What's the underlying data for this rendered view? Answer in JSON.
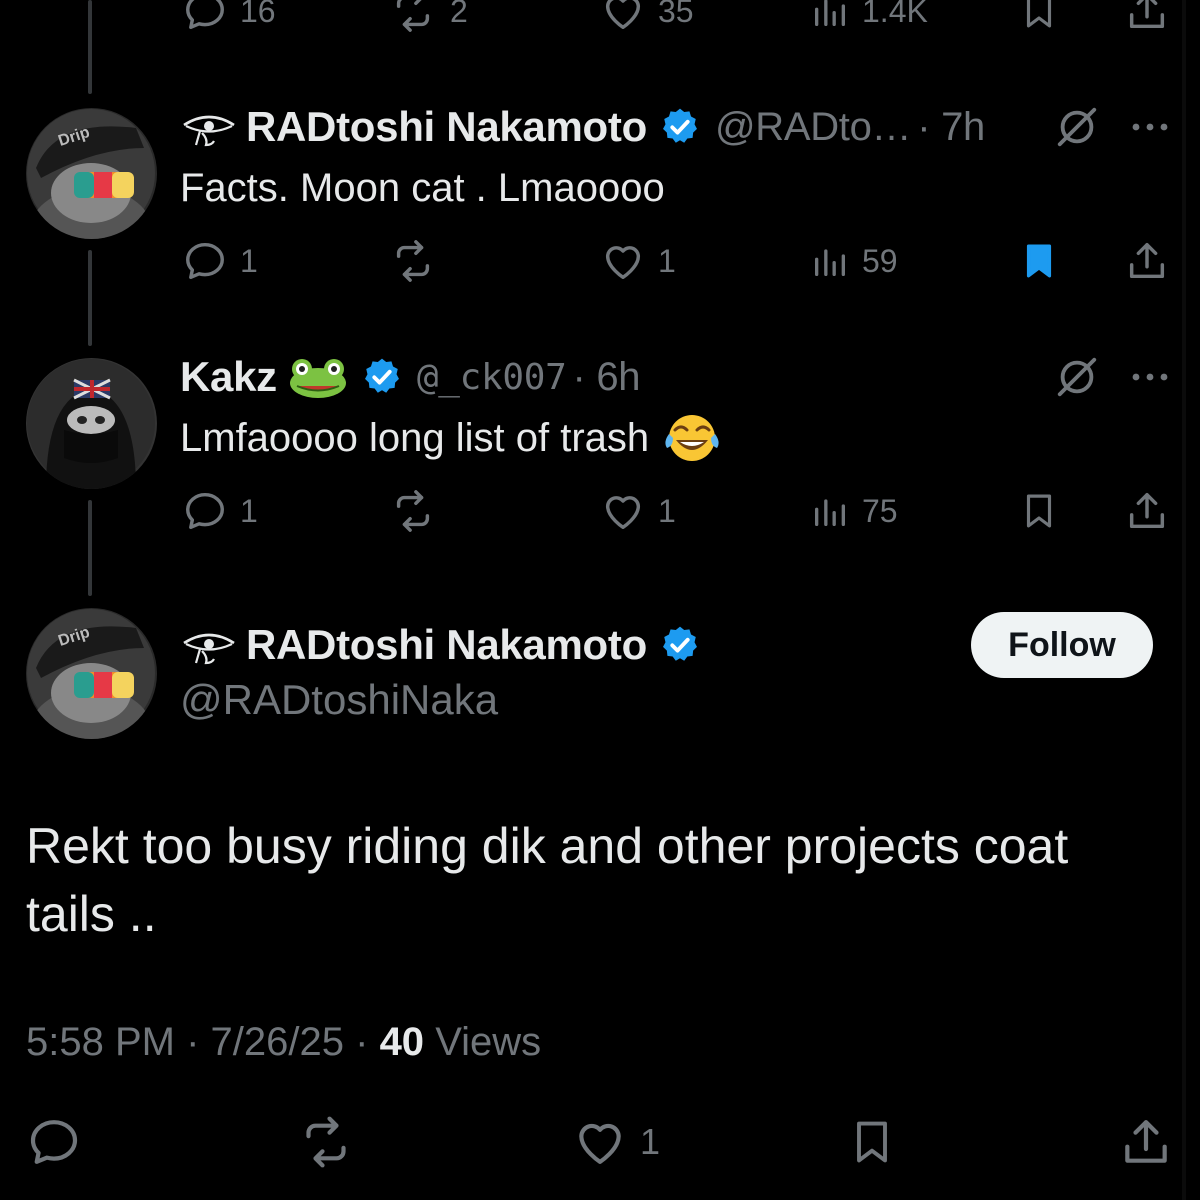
{
  "colors": {
    "background": "#000000",
    "primary_text": "#e7e9ea",
    "secondary_text": "#71767b",
    "verified_blue": "#1d9bf0",
    "bookmark_active": "#1d9bf0",
    "follow_bg": "#eff3f4"
  },
  "top_stats": {
    "replies": "16",
    "reposts": "2",
    "likes": "35",
    "views": "1.4K"
  },
  "reply1": {
    "display_name": "RADtoshi Nakamoto",
    "handle": "@RADto…",
    "time": "· 7h",
    "text": "Facts. Moon cat . Lmaoooo",
    "replies": "1",
    "reposts": "",
    "likes": "1",
    "views": "59",
    "bookmarked": true
  },
  "reply2": {
    "display_name": "Kakz",
    "name_emoji": "🐸",
    "handle": "@_ck007",
    "time": "· 6h",
    "text": "Lmfaoooo long list of trash",
    "text_emoji": "😂",
    "replies": "1",
    "reposts": "",
    "likes": "1",
    "views": "75",
    "bookmarked": false
  },
  "main_tweet": {
    "display_name": "RADtoshi Nakamoto",
    "handle": "@RADtoshiNaka",
    "follow_label": "Follow",
    "text": "Rekt too busy riding dik and  other projects coat tails ..",
    "time": "5:58 PM",
    "date": "7/26/25",
    "views_count": "40",
    "views_label": "Views",
    "likes": "1"
  },
  "icons": {
    "reply": "reply-icon",
    "repost": "repost-icon",
    "like": "heart-icon",
    "views": "analytics-icon",
    "bookmark": "bookmark-icon",
    "share": "share-icon",
    "grok": "grok-icon",
    "more": "more-icon",
    "verified": "verified-badge-icon",
    "eye": "eye-of-horus-icon"
  }
}
